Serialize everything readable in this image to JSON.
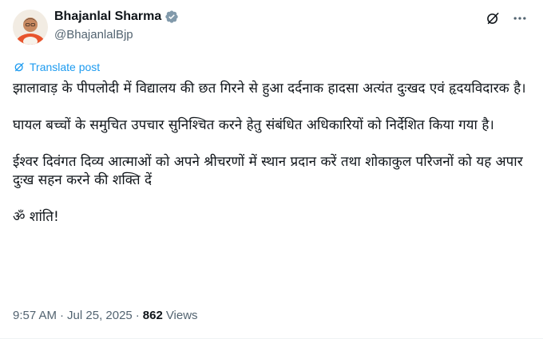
{
  "author": {
    "display_name": "Bhajanlal Sharma",
    "handle": "@BhajanlalBjp",
    "verified_badge_color": "#829aab"
  },
  "actions": {
    "grok_icon": "grok-icon",
    "more_icon": "more-icon"
  },
  "translate": {
    "label": "Translate post",
    "color": "#1d9bf0"
  },
  "post": {
    "paragraphs": [
      "झालावाड़ के पीपलोदी में विद्यालय की छत गिरने से हुआ दर्दनाक हादसा अत्यंत दुःखद एवं हृदयविदारक है।",
      "घायल बच्चों के समुचित उपचार सुनिश्चित करने हेतु संबंधित अधिकारियों को निर्देशित किया गया है।",
      "ईश्वर दिवंगत दिव्य आत्माओं को अपने श्रीचरणों में स्थान प्रदान करें तथा शोकाकुल परिजनों को यह अपार दुःख सहन करने की शक्ति दें",
      "ॐ शांति!"
    ]
  },
  "meta": {
    "time": "9:57 AM",
    "separator": "·",
    "date": "Jul 25, 2025",
    "views_count": "862",
    "views_label": "Views"
  }
}
